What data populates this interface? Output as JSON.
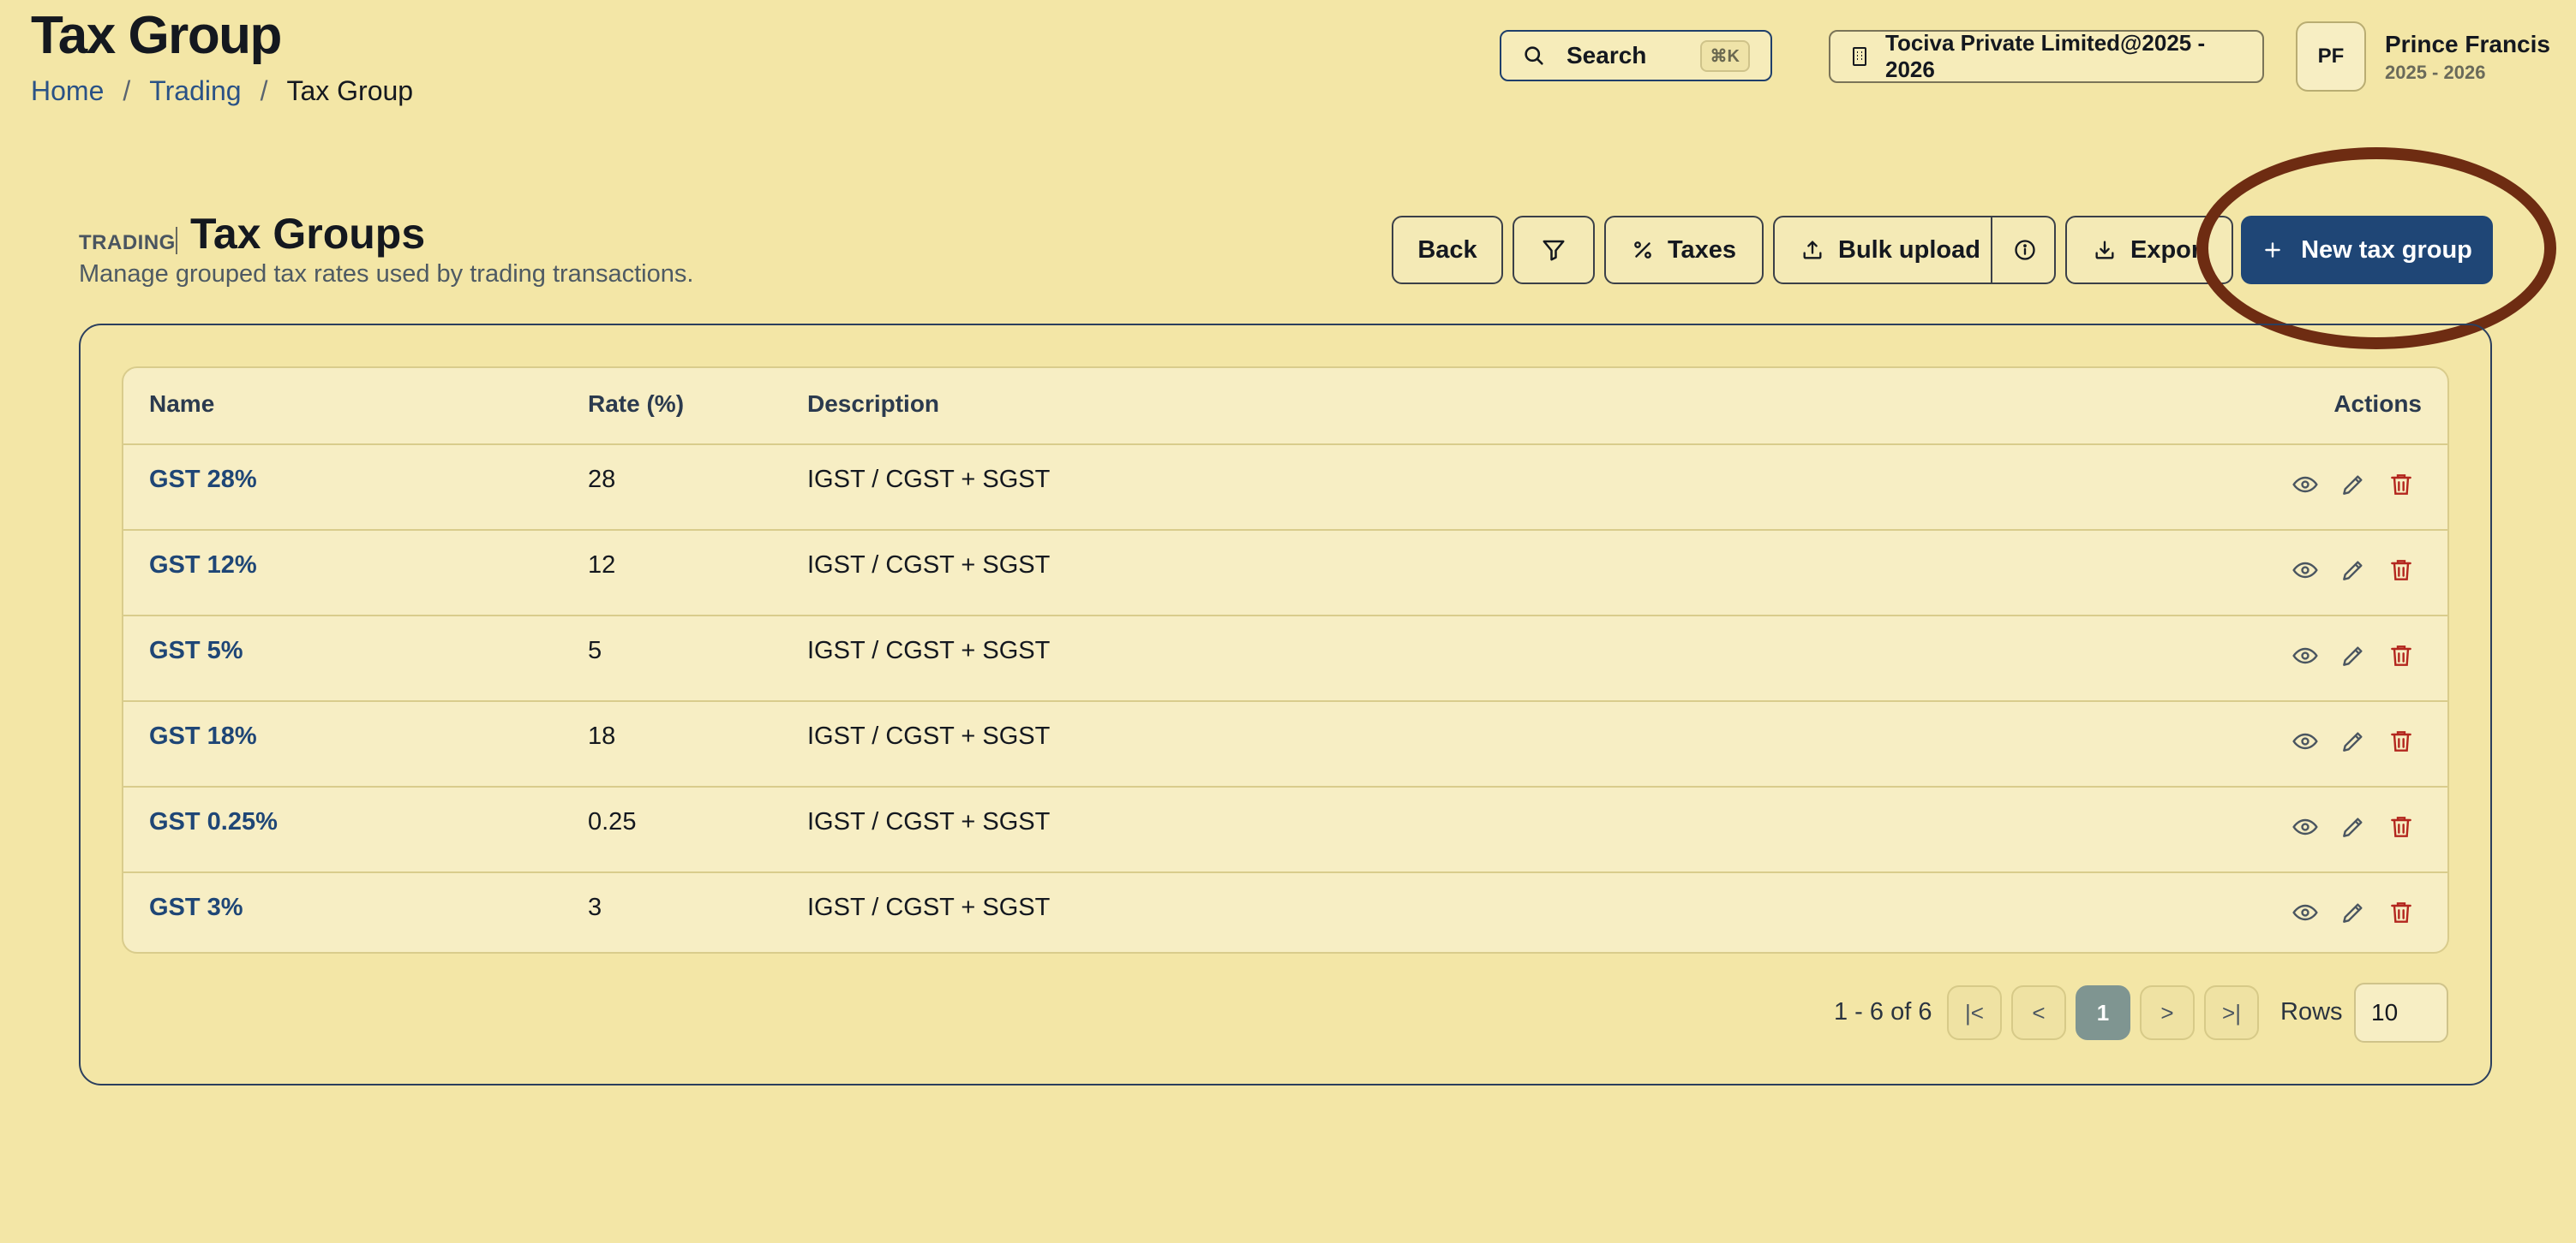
{
  "header": {
    "title": "Tax Group",
    "breadcrumb": [
      "Home",
      "Trading",
      "Tax Group"
    ],
    "breadcrumb_sep": "/"
  },
  "search": {
    "label": "Search",
    "shortcut": "⌘K"
  },
  "company": {
    "label": "Tociva Private Limited@2025 - 2026"
  },
  "user": {
    "initials": "PF",
    "name": "Prince Francis",
    "year": "2025 - 2026"
  },
  "section": {
    "tag": "TRADING",
    "title": "Tax Groups",
    "subtitle": "Manage grouped tax rates used by trading transactions."
  },
  "toolbar": {
    "back": "Back",
    "taxes": "Taxes",
    "bulk_upload": "Bulk upload",
    "export": "Expor",
    "new": "New tax group"
  },
  "table": {
    "headers": {
      "name": "Name",
      "rate": "Rate (%)",
      "description": "Description",
      "actions": "Actions"
    },
    "rows": [
      {
        "name": "GST 28%",
        "rate": "28",
        "description": "IGST / CGST + SGST"
      },
      {
        "name": "GST 12%",
        "rate": "12",
        "description": "IGST / CGST + SGST"
      },
      {
        "name": "GST 5%",
        "rate": "5",
        "description": "IGST / CGST + SGST"
      },
      {
        "name": "GST 18%",
        "rate": "18",
        "description": "IGST / CGST + SGST"
      },
      {
        "name": "GST 0.25%",
        "rate": "0.25",
        "description": "IGST / CGST + SGST"
      },
      {
        "name": "GST 3%",
        "rate": "3",
        "description": "IGST / CGST + SGST"
      }
    ]
  },
  "pagination": {
    "summary": "1 - 6 of 6",
    "first": "|<",
    "prev": "<",
    "current": "1",
    "next": ">",
    "last": ">|",
    "rows_label": "Rows",
    "rows_value": "10"
  },
  "colors": {
    "background": "#f3e6a6",
    "primary": "#1f4676",
    "link": "#2a5286",
    "delete": "#b3261e",
    "highlight_ring": "#6e2c12"
  }
}
